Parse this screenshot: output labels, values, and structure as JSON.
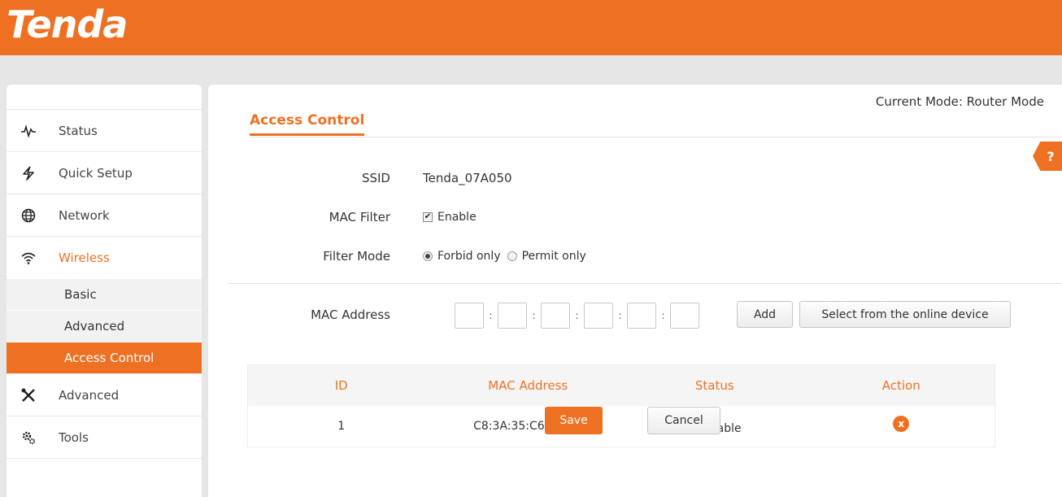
{
  "header": {
    "logo_text": "Tenda"
  },
  "sidebar": {
    "items": [
      {
        "label": "Status",
        "icon": "pulse-icon"
      },
      {
        "label": "Quick Setup",
        "icon": "lightning-icon"
      },
      {
        "label": "Network",
        "icon": "globe-icon"
      },
      {
        "label": "Wireless",
        "icon": "wifi-icon",
        "active": true
      },
      {
        "label": "Advanced",
        "icon": "tools-cross-icon"
      },
      {
        "label": "Tools",
        "icon": "gears-icon"
      }
    ],
    "wireless_sub": [
      {
        "label": "Basic"
      },
      {
        "label": "Advanced"
      },
      {
        "label": "Access Control",
        "active": true
      }
    ]
  },
  "main": {
    "mode_text": "Current Mode: Router Mode",
    "title": "Access Control",
    "help_label": "?",
    "ssid_label": "SSID",
    "ssid_value": "Tenda_07A050",
    "mac_filter_label": "MAC Filter",
    "mac_filter_option": "Enable",
    "filter_mode_label": "Filter Mode",
    "filter_mode_options": [
      "Forbid only",
      "Permit only"
    ],
    "filter_mode_selected": "Forbid only",
    "mac_address_label": "MAC Address",
    "mac_separator": ":",
    "add_button": "Add",
    "select_button": "Select from the online device"
  },
  "table": {
    "headers": [
      "ID",
      "MAC Address",
      "Status",
      "Action"
    ],
    "rows": [
      {
        "id": "1",
        "mac": "C8:3A:35:C6:B3:C7",
        "status": "Enable",
        "action": "x"
      }
    ]
  },
  "footer": {
    "save_label": "Save",
    "cancel_label": "Cancel"
  },
  "colors": {
    "accent": "#ee7123",
    "background": "#e6e6e6"
  }
}
